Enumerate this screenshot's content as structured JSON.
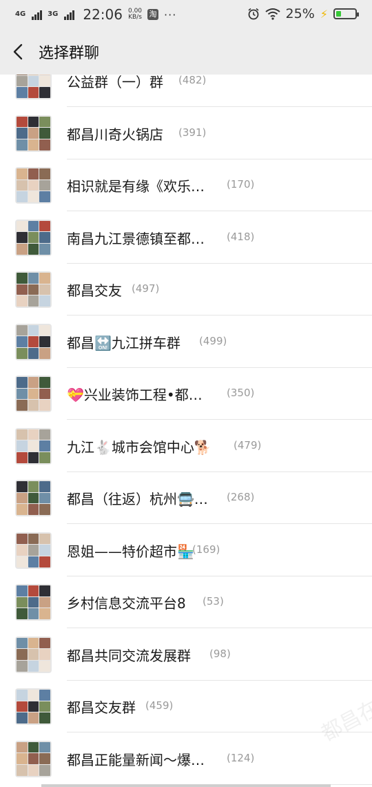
{
  "status_bar": {
    "network_1": "4G",
    "network_2": "3G",
    "time": "22:06",
    "speed_value": "0.00",
    "speed_unit": "KB/s",
    "taobao_glyph": "淘",
    "more_dots": "···",
    "battery_percent": "25%",
    "battery_level": 0.25,
    "icons": [
      "alarm-icon",
      "wifi-icon",
      "charging-bolt-icon",
      "battery-icon"
    ]
  },
  "navbar": {
    "title": "选择群聊",
    "back_icon": "chevron-left-icon"
  },
  "groups": [
    {
      "name": "公益群（一）群",
      "count": "(482)"
    },
    {
      "name": "都昌川奇火锅店",
      "count": "(391)"
    },
    {
      "name": "相识就是有缘《欢乐…",
      "count": "(170)"
    },
    {
      "name": "南昌九江景德镇至都…",
      "count": "(418)"
    },
    {
      "name": "都昌交友",
      "count": "(497)"
    },
    {
      "name": "都昌🔛九江拼车群",
      "count": "(499)"
    },
    {
      "name": "💝兴业装饰工程•都…",
      "count": "(350)"
    },
    {
      "name": "九江🐇城市会馆中心🐕",
      "count": "(479)"
    },
    {
      "name": "都昌（往返）杭州🚍…",
      "count": "(268)"
    },
    {
      "name": "恩姐——特价超市🏪",
      "count": "(169)"
    },
    {
      "name": "乡村信息交流平台8",
      "count": "(53)"
    },
    {
      "name": "都昌共同交流发展群",
      "count": "(98)"
    },
    {
      "name": "都昌交友群",
      "count": "(459)"
    },
    {
      "name": "都昌正能量新闻～爆…",
      "count": "(124)"
    }
  ],
  "watermark": "都昌在线"
}
